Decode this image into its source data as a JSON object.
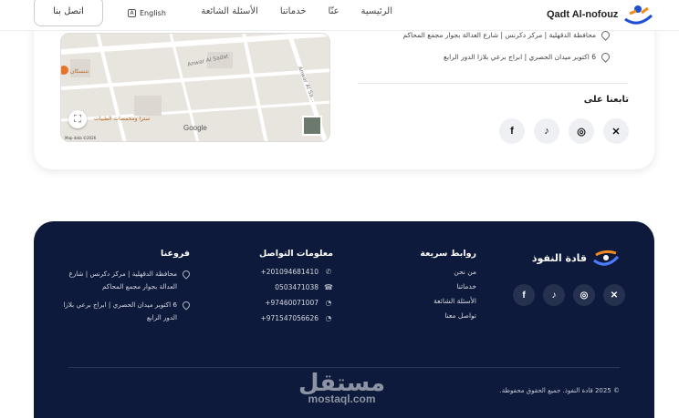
{
  "nav": {
    "contact_button": "اتصل بنا",
    "language": "English",
    "links": [
      "الرئيسية",
      "عنّا",
      "خدماتنا",
      "الأسئلة الشائعة"
    ],
    "brand_name": "Qadt Al-nofouz"
  },
  "map": {
    "street_1": "Anwar Al Sadat",
    "street_2": "Anwar Al Sa...",
    "poi_1": "نتنسكان",
    "poi_2": "سترا ومحمصات الطيبات",
    "google": "Google",
    "attribution": "Map data ©2026"
  },
  "contact_card": {
    "address_1": "محافظة الدقهلية | مركز دكرنس | شارع العدالة بجوار مجمع المحاكم",
    "address_2": "6 اكتوبر ميدان الحصري | ابراج برعي بلازا الدور الرابع",
    "follow_title": "تابعنا على",
    "social_icons": [
      "x-icon",
      "instagram-icon",
      "tiktok-icon",
      "facebook-icon"
    ]
  },
  "footer": {
    "brand_name": "قادة النفوذ",
    "quick_links_title": "روابط سريعة",
    "quick_links": [
      "من نحن",
      "خدماتنا",
      "الأسئلة الشائعة",
      "تواصل معنا"
    ],
    "contact_title": "معلومات التواصل",
    "phone_1": "+201094681410",
    "phone_2": "0503471038",
    "whatsapp_1": "+97460071007",
    "whatsapp_2": "+971547056626",
    "branches_title": "فروعنا",
    "branch_1": "محافظة الدقهلية | مركز دكرنس | شارع العدالة بجوار مجمع المحاكم",
    "branch_2": "6 اكتوبر ميدان الحصري | ابراج برعي بلازا الدور الرابع",
    "copyright": "© 2025 قادة النفوذ. جميع الحقوق محفوظة.",
    "watermark_ar": "مستقل",
    "watermark_en": "mostaql.com"
  },
  "colors": {
    "footer_bg": "#0e1a3b",
    "accent_orange": "#f28a1e",
    "accent_blue": "#1e4fd6"
  }
}
